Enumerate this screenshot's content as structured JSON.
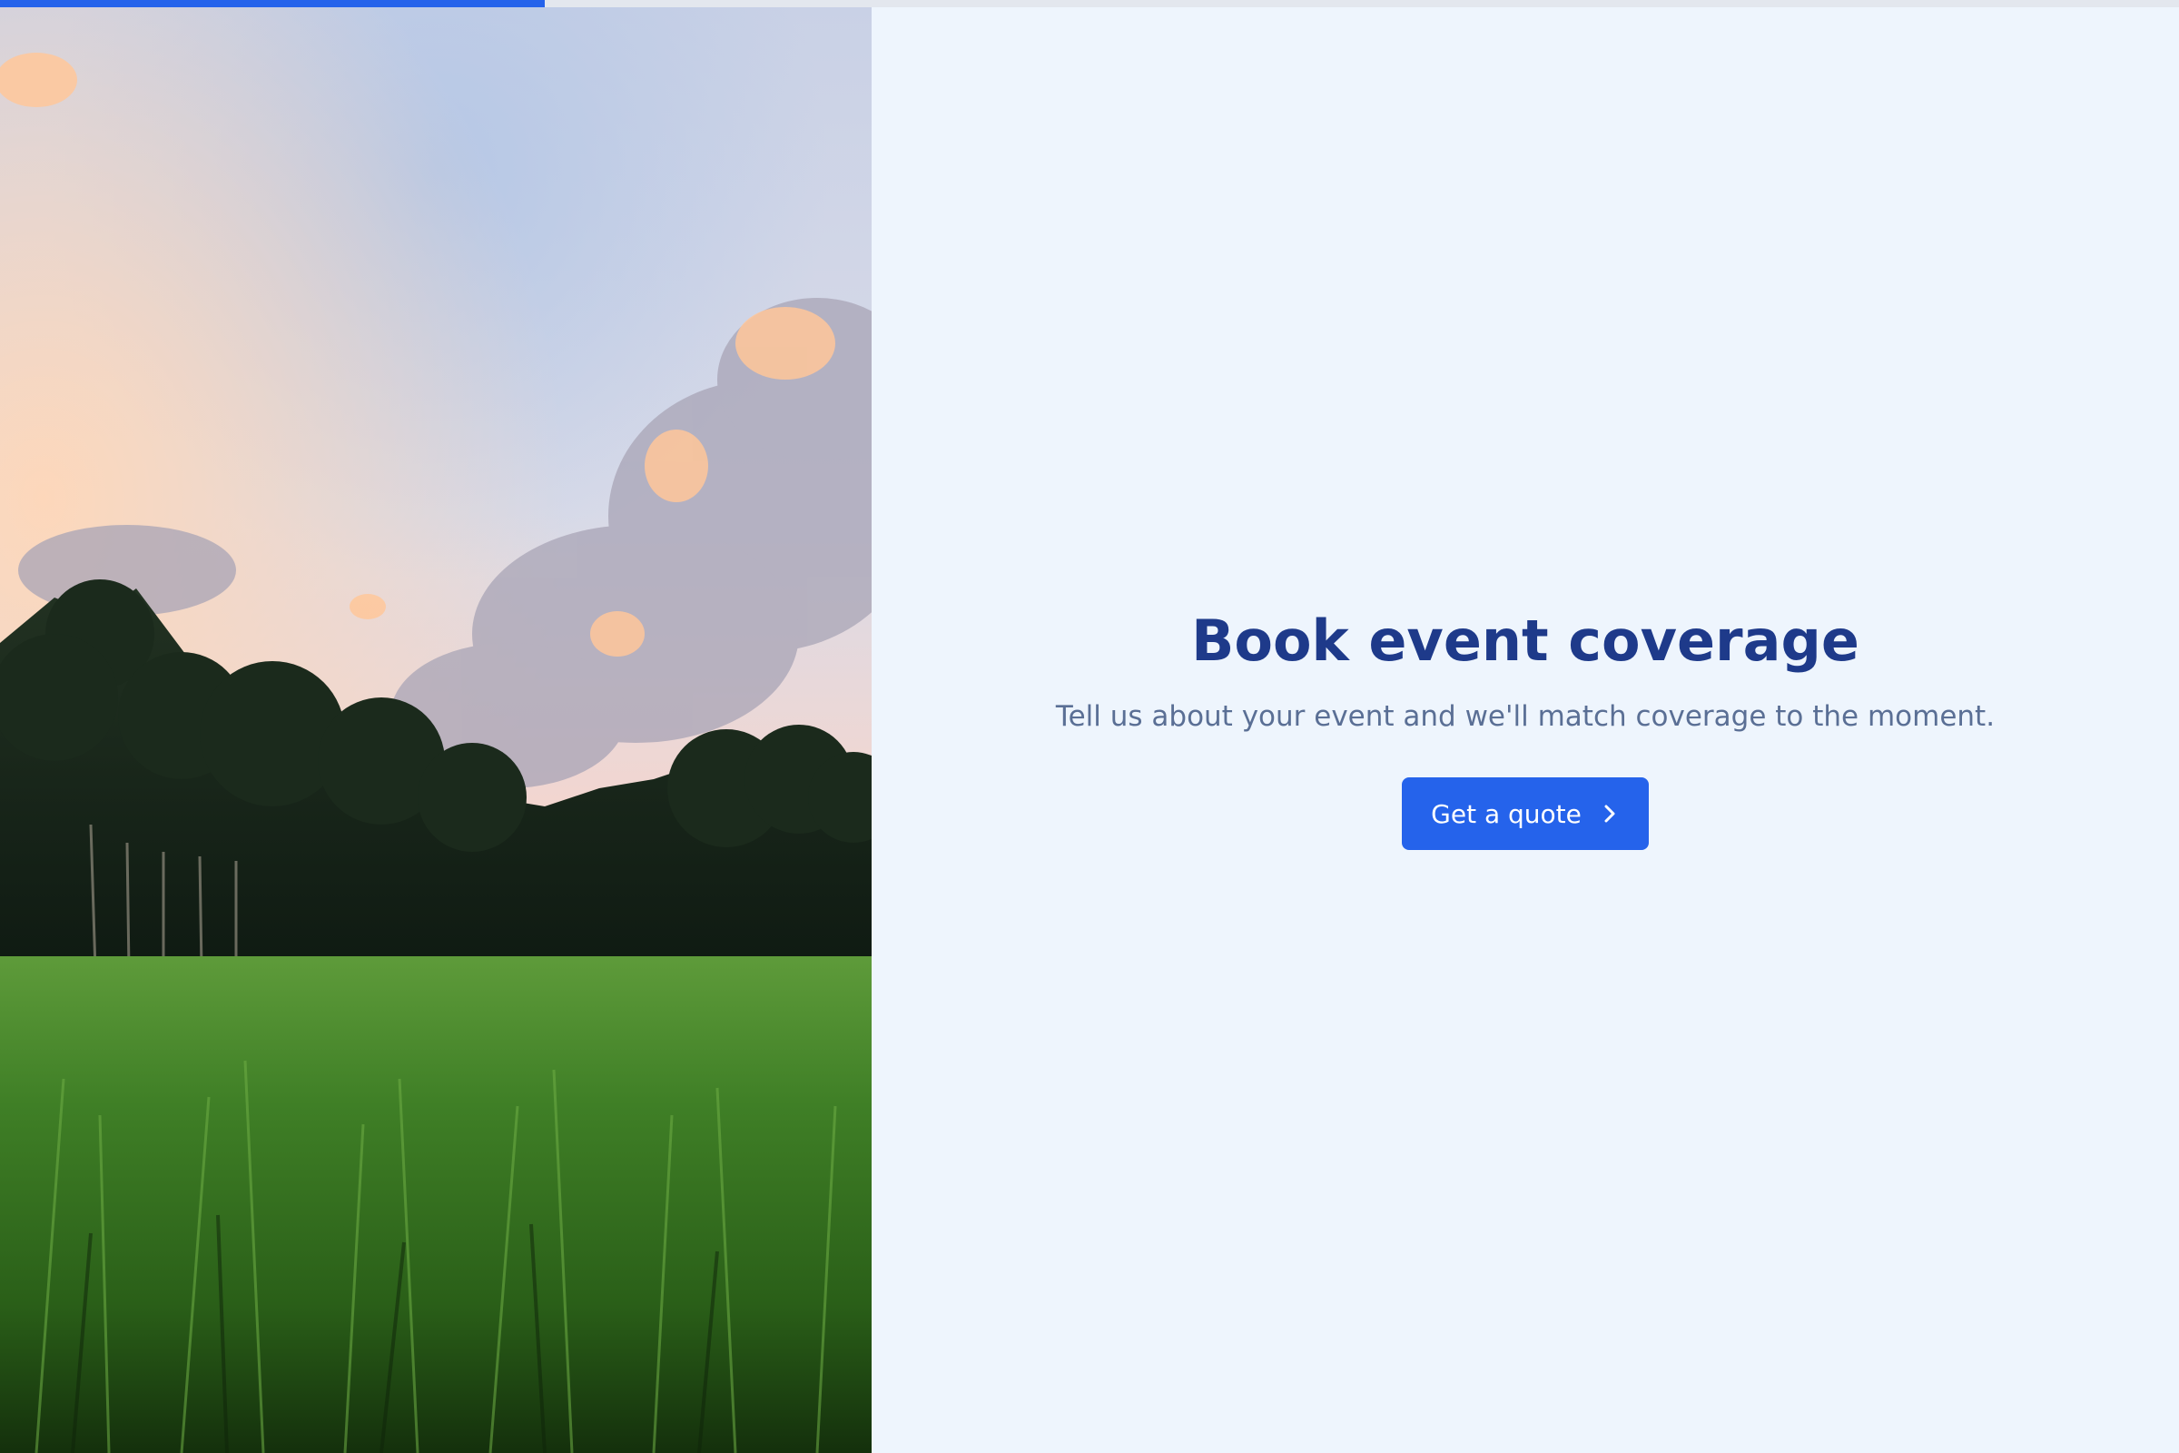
{
  "progress": {
    "fraction": 0.25
  },
  "hero_image": {
    "description_icon": "landscape-photo"
  },
  "content": {
    "headline": "Book event coverage",
    "subheadline": "Tell us about your event and we'll match coverage to the moment.",
    "cta_label": "Get a quote",
    "cta_icon": "chevron-right-icon"
  },
  "colors": {
    "accent": "#2563eb",
    "headline": "#1e3a8a",
    "subtext": "#5a6f95",
    "background": "#eef5fd",
    "progress_track": "#e3e7ee"
  }
}
